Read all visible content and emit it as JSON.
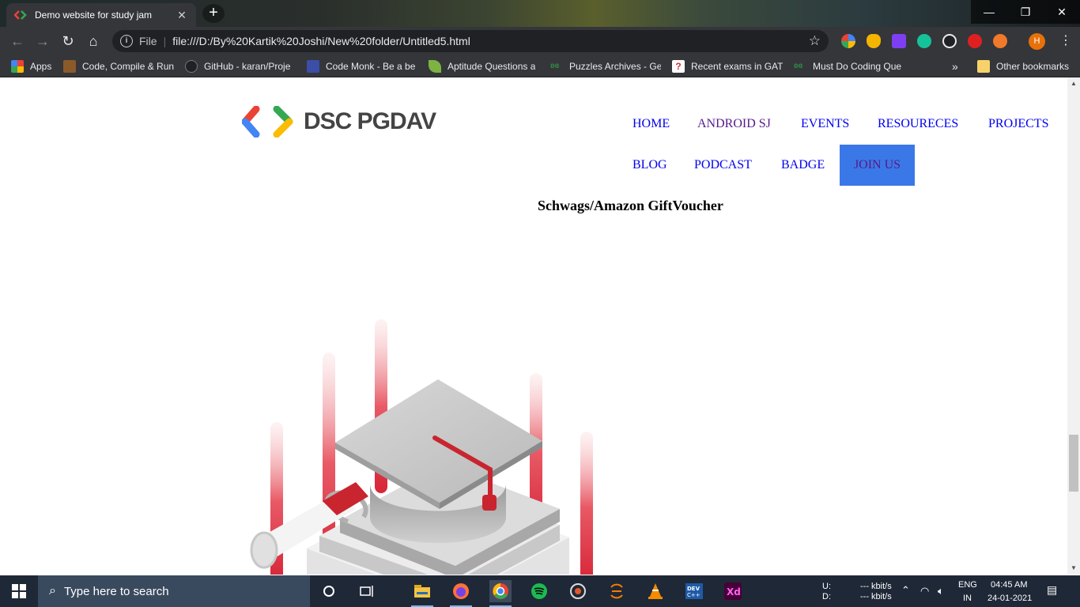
{
  "browser": {
    "tab_title": "Demo website for study jam",
    "tab_close": "✕",
    "new_tab": "+",
    "window_controls": {
      "minimize": "—",
      "restore": "❐",
      "close": "✕"
    },
    "nav": {
      "back": "←",
      "forward": "→",
      "reload": "↻",
      "home": "⌂"
    },
    "omnibox": {
      "info": "i",
      "scheme_label": "File",
      "separator": "|",
      "url": "file:///D:/By%20Kartik%20Joshi/New%20folder/Untitled5.html",
      "star": "☆"
    },
    "profile_initial": "H",
    "menu": "⋮"
  },
  "bookmarks": {
    "items": [
      {
        "label": "Apps",
        "icon": "apps-grid-icon",
        "color": "#e94235"
      },
      {
        "label": "Code, Compile & Run",
        "icon": "codechef-icon",
        "color": "#8b5a2b"
      },
      {
        "label": "GitHub - karan/Proje",
        "icon": "github-icon",
        "color": "#202124"
      },
      {
        "label": "Code Monk - Be a be",
        "icon": "codemonk-icon",
        "color": "#3b4fa8"
      },
      {
        "label": "Aptitude Questions a",
        "icon": "leaf-icon",
        "color": "#7cb342"
      },
      {
        "label": "Puzzles Archives - Ge",
        "icon": "gfg-icon",
        "color": "#2f8d46"
      },
      {
        "label": "Recent exams in GATE",
        "icon": "question-icon",
        "color": "#d32f2f"
      },
      {
        "label": "Must Do Coding Que",
        "icon": "gfg-icon",
        "color": "#2f8d46"
      }
    ],
    "overflow": "»",
    "other": "Other bookmarks"
  },
  "site": {
    "logo_text": "DSC PGDAV",
    "nav": {
      "home": "HOME",
      "android": "ANDROID SJ",
      "events": "EVENTS",
      "resources": "RESOURECES",
      "projects": "PROJECTS",
      "blog": "BLOG",
      "podcast": "PODCAST",
      "badge": "BADGE",
      "join": "JOIN US"
    },
    "heading": "Schwags/Amazon GiftVoucher"
  },
  "scrollbar": {
    "up": "▲",
    "down": "▼"
  },
  "taskbar": {
    "search_placeholder": "Type here to search",
    "tray": {
      "net_labels_up": "U:",
      "net_labels_down": "D:",
      "net_up": "--- kbit/s",
      "net_down": "--- kbit/s",
      "lang_1": "ENG",
      "lang_2": "IN",
      "time": "04:45 AM",
      "date": "24-01-2021"
    }
  },
  "colors": {
    "google_blue": "#4285f4",
    "google_green": "#34a853",
    "google_yellow": "#fbbc04",
    "google_red": "#ea4335",
    "join_button": "#3b78e7"
  }
}
